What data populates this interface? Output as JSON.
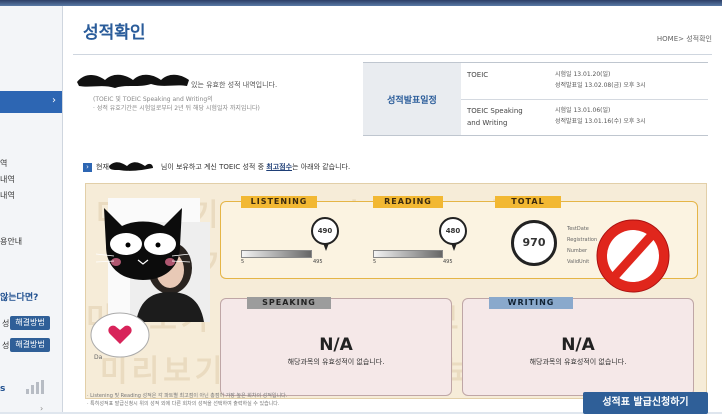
{
  "page": {
    "title": "성적확인",
    "breadcrumb": "HOME> 성적확인"
  },
  "sidebar": {
    "active_chevron": "›",
    "items": [
      "역",
      "내역",
      "내역",
      "용안내"
    ],
    "question": "않는다면?",
    "help_label": "해결방법",
    "help_prefix_1": "성",
    "help_prefix_2": "성",
    "stats_label": "s",
    "more": "›"
  },
  "intro": {
    "line1": "있는 유효한 성적 내역입니다.",
    "line2": "(TOEIC 및 TOEIC Speaking and Writing의",
    "line3": "· 성적 유효기간은 시험일로부터 2년 뒤 해당 시험일자 까지입니다)"
  },
  "schedule": {
    "header": "성적발표일정",
    "rows": [
      {
        "name": "TOEIC",
        "date1": "시험일 13.01.20(일)",
        "date2": "성적발표일 13.02.08(금) 오후 3시"
      },
      {
        "name": "TOEIC Speaking",
        "name2": "and Writing",
        "date1": "시험일 13.01.06(일)",
        "date2": "성적발표일 13.01.16(수) 오후 3시"
      }
    ]
  },
  "notice": {
    "prefix": "현재",
    "middle": "님이 보유하고 계신 TOEIC 성적 중",
    "highlight": "최고점수",
    "suffix": "는 아래와 같습니다."
  },
  "score_card": {
    "watermark": "미리보기 미리보기 미리보기",
    "listening_label": "LISTENING",
    "reading_label": "READING",
    "total_label": "TOTAL",
    "listening_score": "490",
    "reading_score": "480",
    "listening_progress": 0.99,
    "reading_progress": 0.97,
    "scale_min": "5",
    "scale_max": "495",
    "total_score": "970",
    "test_info": [
      "TestDate",
      "Registration",
      "Number",
      "ValidUnit"
    ],
    "photo_caption": "Da",
    "speaking": {
      "label": "SPEAKING",
      "score": "N/A",
      "message": "해당과목의 유효성적이 없습니다."
    },
    "writing": {
      "label": "WRITING",
      "score": "N/A",
      "message": "해당과목의 유효성적이 없습니다."
    }
  },
  "footer": {
    "line1": "· Listening 및 Reading 성적은 각 파트별 최고점이 아닌 총점이 가장 높은 회차의 성적입니다.",
    "line2": "· 특히성적표 발급신청시 위의 성적 외에 다른 회차의 성적을 선택하여 출력하실 수 있습니다.",
    "apply_button": "성적표 발급신청하기"
  },
  "colors": {
    "accent": "#2d66b3",
    "brand_blue": "#2a5c9a",
    "tag_yellow": "#f2b833",
    "card_bg": "#f6ecd8",
    "no_sign_red": "#e0261c"
  }
}
